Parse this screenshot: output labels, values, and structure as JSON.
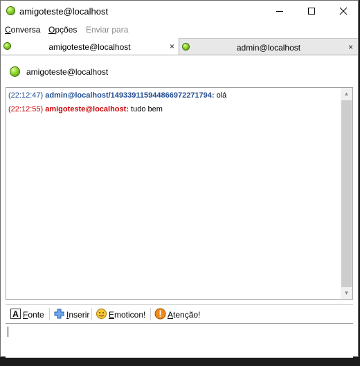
{
  "window": {
    "title": "amigoteste@localhost",
    "controls": [
      "minimize-icon",
      "maximize-icon",
      "close-icon"
    ]
  },
  "menu": [
    {
      "label": "Conversa",
      "mnemonic": "C",
      "rest": "onversa",
      "enabled": true
    },
    {
      "label": "Opções",
      "mnemonic": "O",
      "rest": "pções",
      "enabled": true
    },
    {
      "label": "Enviar para",
      "mnemonic": "",
      "rest": "Enviar para",
      "enabled": false
    }
  ],
  "tabs": [
    {
      "label": "amigoteste@localhost",
      "active": true,
      "close": "×"
    },
    {
      "label": "admin@localhost",
      "active": false,
      "close": "×"
    }
  ],
  "header": {
    "contact": "amigoteste@localhost",
    "status_color": "#7cc420"
  },
  "messages": [
    {
      "time": "(22:12:47)",
      "sender": "admin@localhost/1493391159448669722717​94:",
      "text": " olá",
      "color": "#1f4b8f"
    },
    {
      "time": "(22:12:55)",
      "sender": "amigoteste@localhost:",
      "text": " tudo bem",
      "color": "#cc0000"
    }
  ],
  "toolbar": {
    "font": {
      "mnemonic": "F",
      "rest": "onte",
      "icon": "font-icon"
    },
    "insert": {
      "mnemonic": "I",
      "rest": "nserir",
      "icon": "plus-icon"
    },
    "emoticon": {
      "mnemonic": "E",
      "rest": "moticon!",
      "icon": "smiley-icon"
    },
    "attention": {
      "mnemonic": "A",
      "rest": "tenção!",
      "icon": "warning-icon"
    }
  },
  "input": {
    "value": ""
  }
}
